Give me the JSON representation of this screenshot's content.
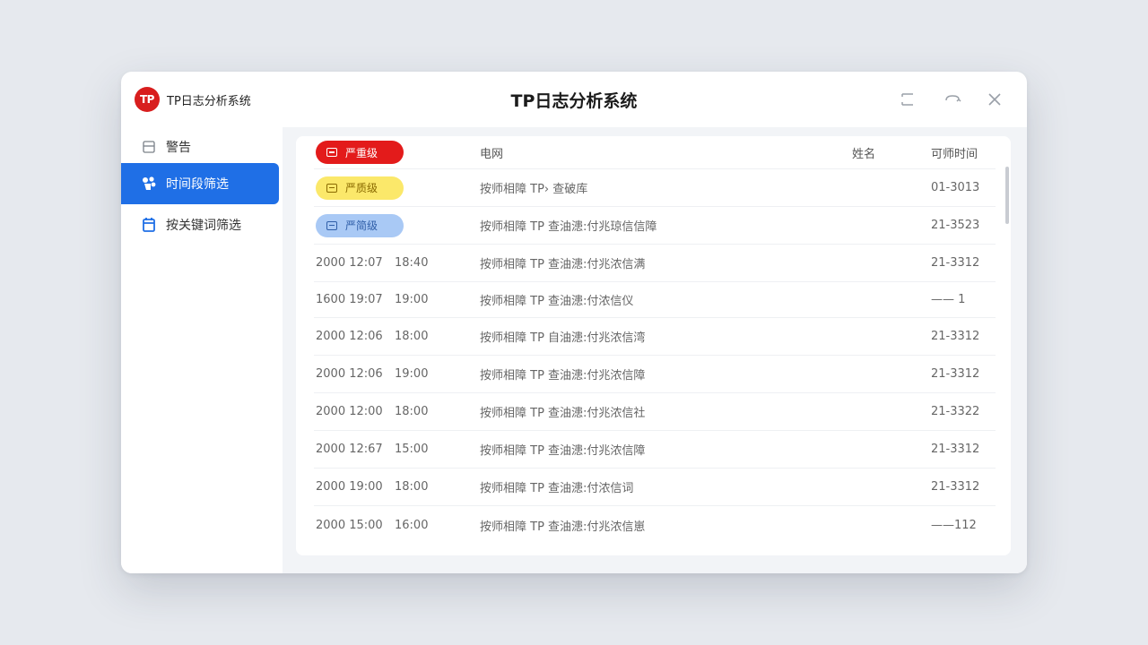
{
  "app": {
    "logo_text": "TP",
    "name": "TP日志分析系统",
    "window_title": "TP日志分析系统",
    "brand_color": "#d81e1e",
    "accent_color": "#1f6fe6"
  },
  "window_controls": [
    "maximize-icon",
    "restore-icon",
    "close-icon"
  ],
  "sidebar": {
    "items": [
      {
        "label": "警告",
        "icon": "log-icon",
        "active": false
      },
      {
        "label": "时间段筛选",
        "icon": "filter-icon",
        "active": true
      },
      {
        "label": "按关键词筛选",
        "icon": "calendar-icon",
        "active": false
      }
    ]
  },
  "table": {
    "columns": [
      "",
      "",
      "电网",
      "姓名",
      "可师时间"
    ],
    "level_tags": [
      {
        "label": "严重级",
        "color": "#e31b1b"
      },
      {
        "label": "严质级",
        "color": "#fbe86a"
      },
      {
        "label": "严简级",
        "color": "#a9c9f5"
      }
    ],
    "tag_rows": [
      {
        "message": "按师相障 TP› 查破库",
        "code": "01-3013"
      },
      {
        "message": "按师相障 TP 查油漶:付兆琼信信障",
        "code": "21-3523"
      }
    ],
    "rows": [
      {
        "date": "2000 12:07",
        "time": "18:40",
        "message": "按师相障 TP 查油漶:付兆浓信满",
        "code": "21-3312"
      },
      {
        "date": "1600 19:07",
        "time": "19:00",
        "message": "按师相障 TP 查油漶:付浓信仪",
        "code": "—— 1"
      },
      {
        "date": "2000 12:06",
        "time": "18:00",
        "message": "按师相障 TP 自油漶:付兆浓信湾",
        "code": "21-3312"
      },
      {
        "date": "2000 12:06",
        "time": "19:00",
        "message": "按师相障 TP 查油漶:付兆浓信障",
        "code": "21-3312"
      },
      {
        "date": "2000 12:00",
        "time": "18:00",
        "message": "按师相障 TP 查油漶:付兆浓信社",
        "code": "21-3322"
      },
      {
        "date": "2000 12:67",
        "time": "15:00",
        "message": "按师相障 TP 查油漶:付兆浓信障",
        "code": "21-3312"
      },
      {
        "date": "2000 19:00",
        "time": "18:00",
        "message": "按师相障 TP 查油漶:付浓信词",
        "code": "21-3312"
      },
      {
        "date": "2000 15:00",
        "time": "16:00",
        "message": "按师相障 TP 查油漶:付兆浓信崽",
        "code": "——112"
      }
    ]
  }
}
